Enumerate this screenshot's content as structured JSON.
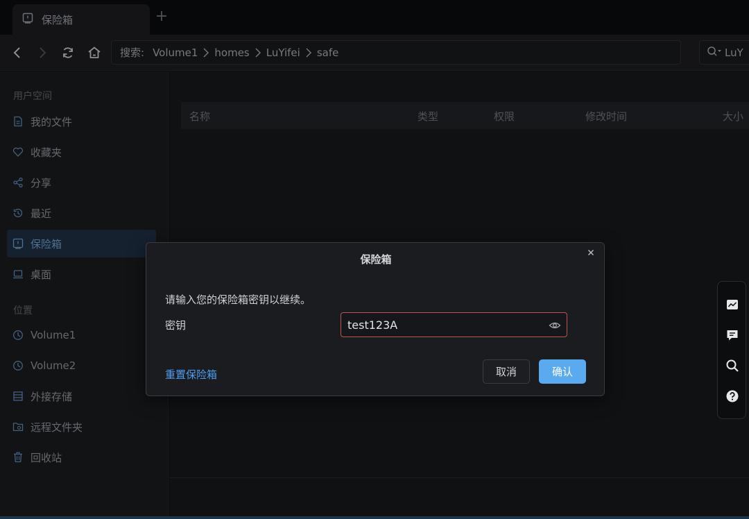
{
  "tab": {
    "title": "保险箱",
    "icon": "safe-icon",
    "add_icon": "+"
  },
  "toolbar": {
    "search_prefix": "搜索:",
    "breadcrumbs": [
      "Volume1",
      "homes",
      "LuYifei",
      "safe"
    ],
    "search_value": "LuY"
  },
  "sidebar": {
    "section_user": "用户空间",
    "user_items": [
      {
        "label": "我的文件",
        "icon": "document-icon"
      },
      {
        "label": "收藏夹",
        "icon": "heart-icon"
      },
      {
        "label": "分享",
        "icon": "share-icon"
      },
      {
        "label": "最近",
        "icon": "history-icon"
      },
      {
        "label": "保险箱",
        "icon": "safe-icon",
        "active": true
      },
      {
        "label": "桌面",
        "icon": "desktop-icon"
      }
    ],
    "section_location": "位置",
    "location_items": [
      {
        "label": "Volume1",
        "icon": "volume-icon"
      },
      {
        "label": "Volume2",
        "icon": "volume-icon"
      },
      {
        "label": "外接存储",
        "icon": "storage-icon"
      },
      {
        "label": "远程文件夹",
        "icon": "remote-folder-icon"
      },
      {
        "label": "回收站",
        "icon": "trash-icon"
      }
    ]
  },
  "table": {
    "columns": [
      "名称",
      "类型",
      "权限",
      "修改时间",
      "大小"
    ]
  },
  "dialog": {
    "title": "保险箱",
    "message": "请输入您的保险箱密钥以继续。",
    "field_label": "密钥",
    "field_value": "test123A",
    "reset_link": "重置保险箱",
    "cancel_label": "取消",
    "confirm_label": "确认"
  },
  "colors": {
    "accent": "#5aaaf0",
    "link": "#4d9ef0",
    "error_border": "#c0524f",
    "active_nav_bg": "#1e2f42"
  }
}
